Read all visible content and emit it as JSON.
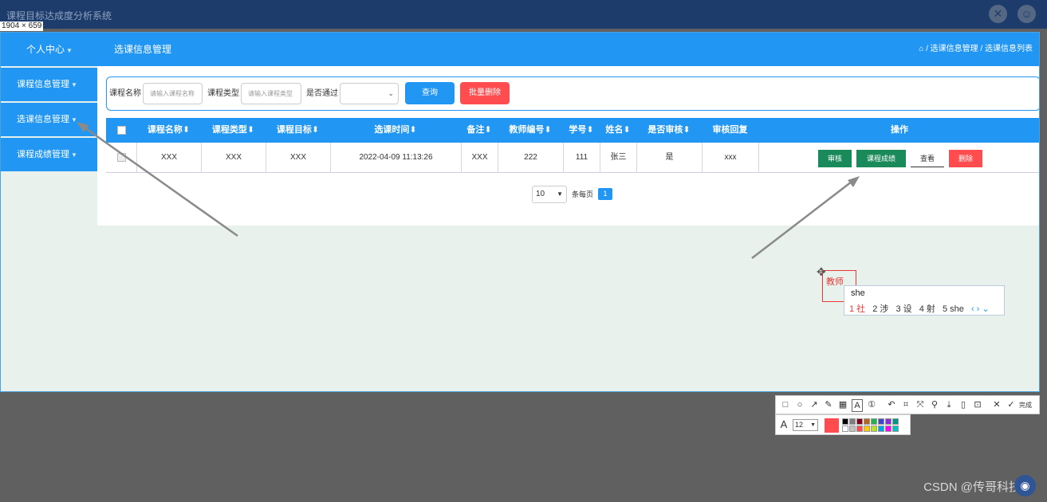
{
  "window": {
    "title": "课程目标达成度分析系统",
    "size_badge": "1904 × 659",
    "close_icon": "✕",
    "user_icon": "☺"
  },
  "header": {
    "user_menu": "个人中心",
    "page_title": "选课信息管理",
    "breadcrumb": "⌂ / 选课信息管理 / 选课信息列表"
  },
  "sidebar": {
    "items": [
      {
        "label": "课程信息管理"
      },
      {
        "label": "选课信息管理"
      },
      {
        "label": "课程成绩管理"
      }
    ]
  },
  "search": {
    "course_name_label": "课程名称",
    "course_name_placeholder": "请输入课程名称",
    "course_type_label": "课程类型",
    "course_type_placeholder": "请输入课程类型",
    "passed_label": "是否通过",
    "passed_value": "",
    "query_button": "查询",
    "batch_delete_button": "批量删除"
  },
  "table": {
    "columns": [
      "课程名称",
      "课程类型",
      "课程目标",
      "选课时间",
      "备注",
      "教师编号",
      "学号",
      "姓名",
      "是否审核",
      "审核回复",
      "操作"
    ],
    "rows": [
      {
        "course_name": "XXX",
        "course_type": "XXX",
        "course_goal": "XXX",
        "time": "2022-04-09 11:13:26",
        "remark": "XXX",
        "teacher_no": "222",
        "student_no": "111",
        "name": "张三",
        "reviewed": "是",
        "reply": "xxx"
      }
    ],
    "actions": {
      "review": "审核",
      "grades": "课程成绩",
      "view": "查看",
      "delete": "删除"
    }
  },
  "pagination": {
    "page_size": "10",
    "per_page_label": "条每页",
    "current_page": "1"
  },
  "annotation": {
    "text_box": "教师"
  },
  "ime": {
    "input": "she",
    "candidates": [
      "1 社",
      "2 涉",
      "3 设",
      "4 射",
      "5 she"
    ]
  },
  "screenshot_toolbar": {
    "done_label": "完成",
    "font_size": "12",
    "current_color": "#ff4d4f",
    "palette": [
      "#000000",
      "#7f7f7f",
      "#880015",
      "#b5651d",
      "#22b14c",
      "#3f48cc",
      "#8a2be2",
      "#009688",
      "#ffffff",
      "#c3c3c3",
      "#ff4d4f",
      "#ffc90e",
      "#b5e61d",
      "#00a2e8",
      "#ff00ff",
      "#00c0c0"
    ]
  },
  "watermark": "CSDN @传哥科技",
  "colors": {
    "primary": "#2196f3",
    "danger": "#ff4d4f",
    "success": "#1a8a5a",
    "window_bar": "#1d3c6b"
  }
}
